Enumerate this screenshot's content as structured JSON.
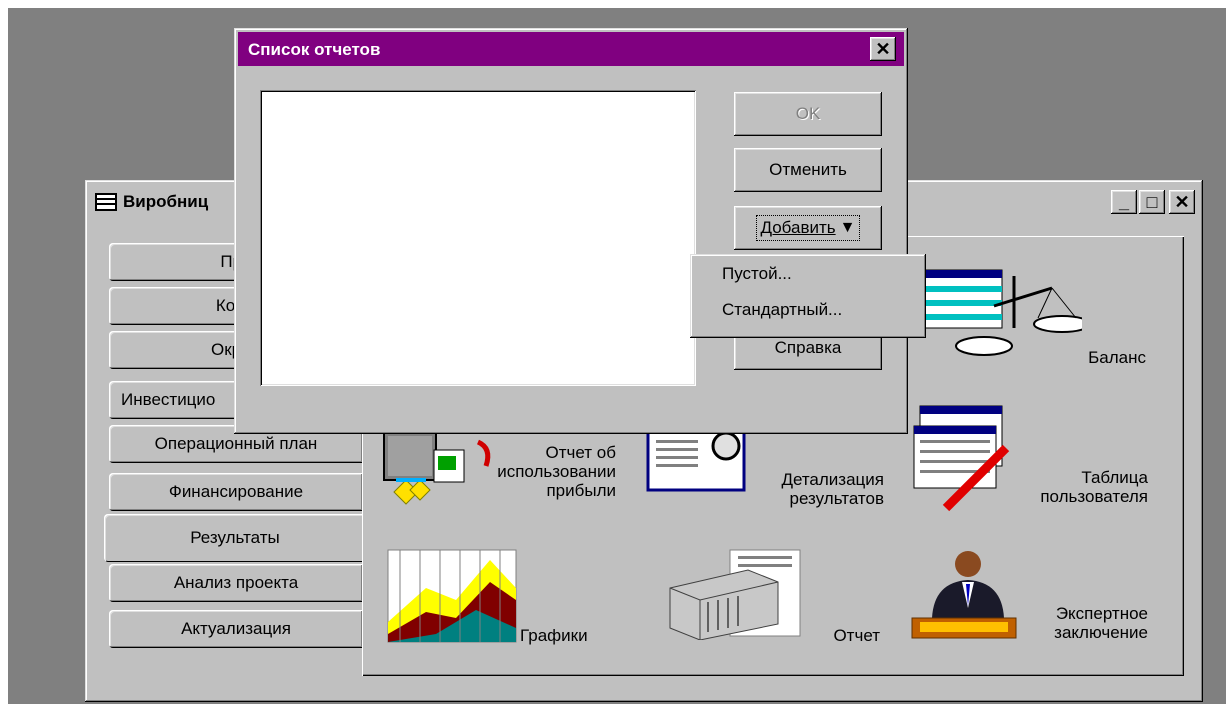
{
  "main_window": {
    "title": "Виробниц",
    "controls": {
      "minimize": "_",
      "maximize": "□",
      "close": "✕"
    }
  },
  "tabs": [
    {
      "label": "Про"
    },
    {
      "label": "Комп"
    },
    {
      "label": "Окруж"
    },
    {
      "label": "Инвестицио"
    },
    {
      "label": "Операционный план"
    },
    {
      "label": "Финансирование"
    },
    {
      "label": "Результаты"
    },
    {
      "label": "Анализ проекта"
    },
    {
      "label": "Актуализация"
    }
  ],
  "reports": [
    {
      "line1": "Отчет об",
      "line2": "использовании",
      "line3": "прибыли"
    },
    {
      "line1": "Детализация",
      "line2": "результатов"
    },
    {
      "line1": "Таблица",
      "line2": "пользователя"
    },
    {
      "line1": "Баланс"
    },
    {
      "line1": "Графики"
    },
    {
      "line1": "Отчет"
    },
    {
      "line1": "Экспертное",
      "line2": "заключение"
    }
  ],
  "dialog": {
    "title": "Список отчетов",
    "close": "✕",
    "buttons": {
      "ok": "OK",
      "cancel": "Отменить",
      "add": "Добавить",
      "help": "Справка"
    },
    "add_arrow": "▼"
  },
  "dropdown": {
    "items": [
      "Пустой...",
      "Стандартный..."
    ]
  },
  "colors": {
    "dialog_title_bg": "#800080",
    "desktop": "#808080",
    "face": "#c0c0c0"
  }
}
